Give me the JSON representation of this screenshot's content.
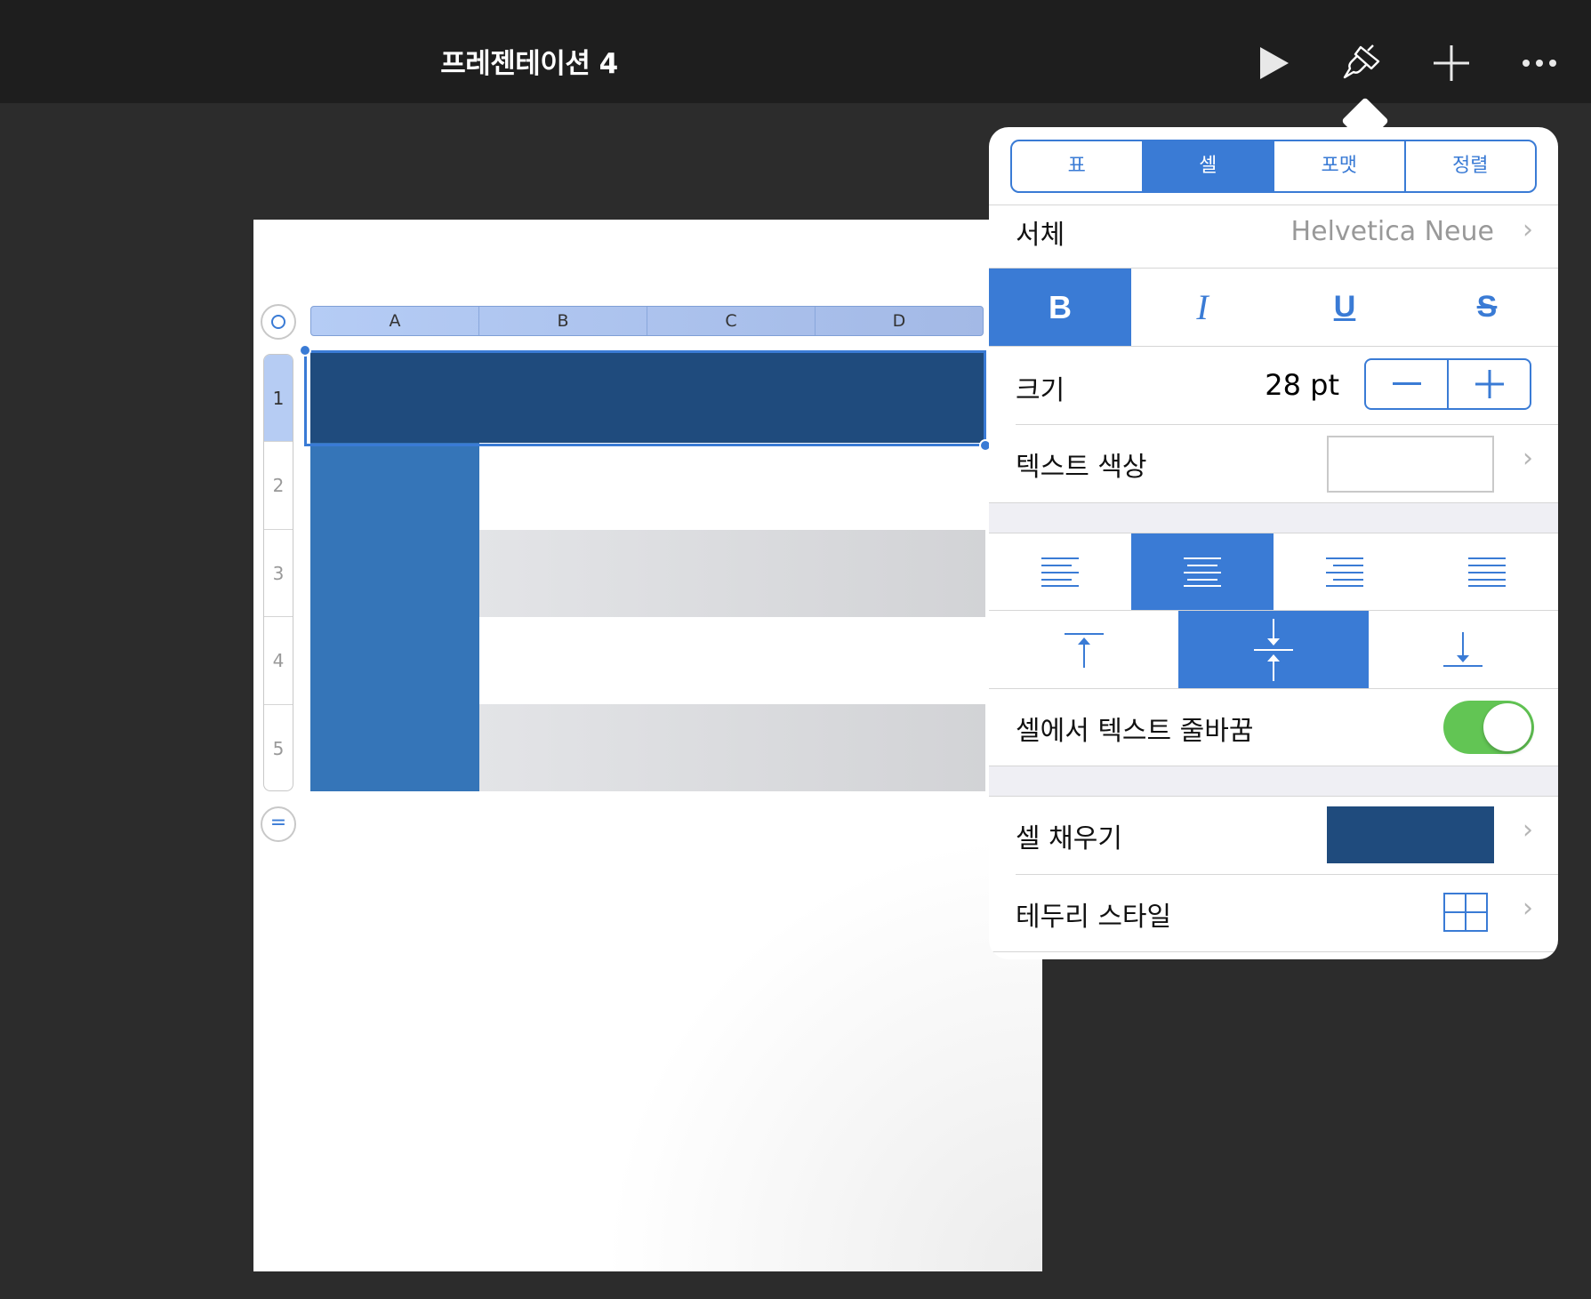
{
  "app": {
    "document_title": "프레젠테이션 4"
  },
  "toolbar": {
    "icons": [
      "play-icon",
      "paintbrush-icon",
      "plus-icon",
      "more-icon"
    ]
  },
  "table": {
    "columns": [
      "A",
      "B",
      "C",
      "D"
    ],
    "rows": [
      "1",
      "2",
      "3",
      "4",
      "5"
    ],
    "selected_row": "1",
    "header_fill": "#1f4b7d",
    "first_column_fill": "#3575b8"
  },
  "format_panel": {
    "tabs": [
      "표",
      "셀",
      "포맷",
      "정렬"
    ],
    "active_tab": "셀",
    "font": {
      "label": "서체",
      "value": "Helvetica Neue"
    },
    "text_styles": {
      "bold": "B",
      "italic": "I",
      "underline": "U",
      "strikethrough": "S",
      "active": "bold"
    },
    "size": {
      "label": "크기",
      "value": "28 pt",
      "decrement": "−",
      "increment": "+"
    },
    "text_color": {
      "label": "텍스트 색상",
      "color": "#ffffff"
    },
    "horizontal_alignment": {
      "options": [
        "left",
        "center",
        "right",
        "justify"
      ],
      "active": "center"
    },
    "vertical_alignment": {
      "options": [
        "top",
        "middle",
        "bottom"
      ],
      "active": "middle"
    },
    "wrap_text": {
      "label": "셀에서 텍스트 줄바꿈",
      "enabled": true
    },
    "cell_fill": {
      "label": "셀 채우기",
      "color": "#1f4b7d"
    },
    "border_style": {
      "label": "테두리 스타일"
    }
  },
  "colors": {
    "accent": "#3a7bd5",
    "toggle_on": "#62c554"
  }
}
